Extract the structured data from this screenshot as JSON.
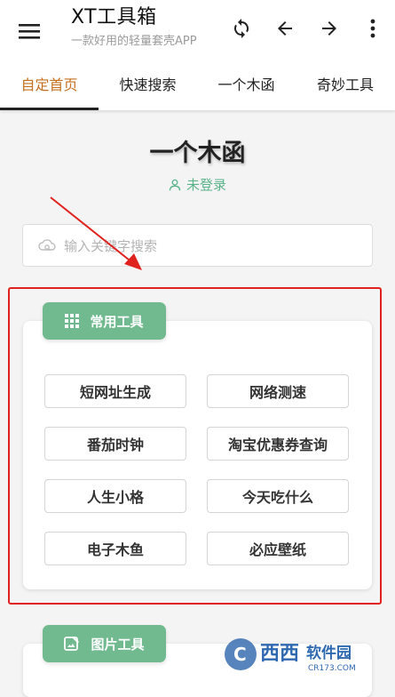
{
  "app": {
    "title": "XT工具箱",
    "subtitle": "一款好用的轻量套壳APP"
  },
  "toolbar_icons": [
    "menu-icon",
    "refresh-icon",
    "arrow-left-icon",
    "arrow-right-icon",
    "more-vertical-icon"
  ],
  "tabs": [
    {
      "label": "自定首页",
      "active": true
    },
    {
      "label": "快速搜索",
      "active": false
    },
    {
      "label": "一个木函",
      "active": false
    },
    {
      "label": "奇妙工具",
      "active": false
    }
  ],
  "page": {
    "title": "一个木函",
    "login_status": "未登录"
  },
  "search": {
    "placeholder": "输入关键字搜索"
  },
  "sections": [
    {
      "tag": "常用工具",
      "icon": "grid-icon",
      "tools": [
        "短网址生成",
        "网络测速",
        "番茄时钟",
        "淘宝优惠券查询",
        "人生小格",
        "今天吃什么",
        "电子木鱼",
        "必应壁纸"
      ]
    },
    {
      "tag": "图片工具",
      "icon": "image-edit-icon",
      "tools": []
    }
  ],
  "watermark": {
    "brand": "西西",
    "text": "软件园",
    "domain": "CR173.COM"
  },
  "colors": {
    "accent_tab": "#c56f1e",
    "tag_green": "#71ba8f",
    "login_green": "#5bb38a",
    "annotation_red": "#e0221f"
  }
}
